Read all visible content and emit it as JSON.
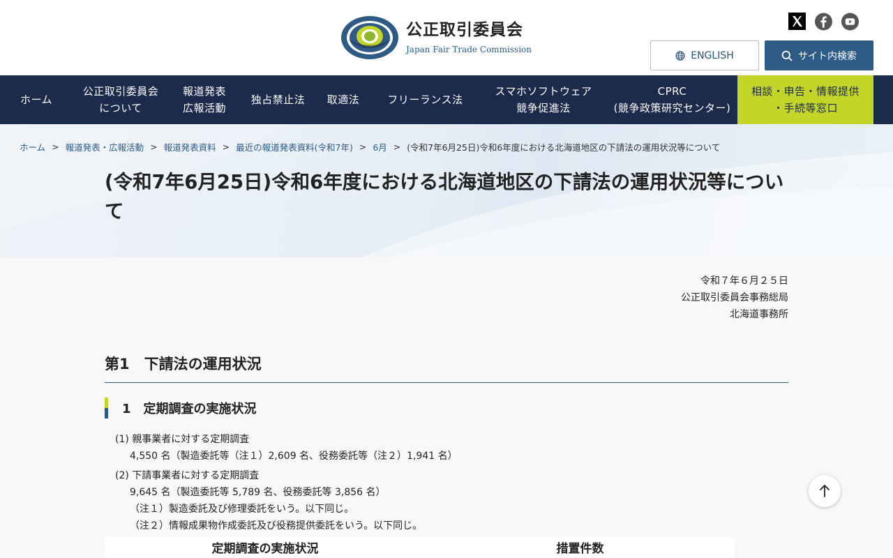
{
  "header": {
    "logo_jp": "公正取引委員会",
    "logo_en": "Japan Fair Trade Commission",
    "logo_seal_text": "JAPAN FAIR TRADE COMMISSION",
    "english_label": "ENGLISH",
    "search_label": "サイト内検索"
  },
  "social": [
    {
      "name": "x-icon"
    },
    {
      "name": "facebook-icon"
    },
    {
      "name": "youtube-icon"
    }
  ],
  "nav": {
    "items": [
      {
        "label": "ホーム"
      },
      {
        "label": "公正取引委員会\nについて"
      },
      {
        "label": "報道発表\n広報活動"
      },
      {
        "label": "独占禁止法"
      },
      {
        "label": "取適法"
      },
      {
        "label": "フリーランス法"
      },
      {
        "label": "スマホソフトウェア\n競争促進法"
      },
      {
        "label": "CPRC\n(競争政策研究センター)"
      },
      {
        "label": "相談・申告・情報提供\n・手続等窓口"
      }
    ]
  },
  "breadcrumb": {
    "items": [
      {
        "label": "ホーム"
      },
      {
        "label": "報道発表・広報活動"
      },
      {
        "label": "報道発表資料"
      },
      {
        "label": "最近の報道発表資料(令和7年)"
      },
      {
        "label": "6月"
      },
      {
        "label": "(令和7年6月25日)令和6年度における北海道地区の下請法の運用状況等について"
      }
    ],
    "separator": ">"
  },
  "page_title": "(令和7年6月25日)令和6年度における北海道地区の下請法の運用状況等について",
  "date_block": {
    "date": "令和７年６月２５日",
    "org": "公正取引委員会事務総局",
    "office": "北海道事務所"
  },
  "section": {
    "h2": "第1　下請法の運用状況",
    "h3": "1　定期調査の実施状況",
    "item1_title": "(1) 親事業者に対する定期調査",
    "item1_detail": "4,550 名（製造委託等（注１）2,609 名、役務委託等（注２）1,941 名）",
    "item2_title": "(2) 下請事業者に対する定期調査",
    "item2_detail": "9,645 名（製造委託等 5,789 名、役務委託等 3,856 名）",
    "note1": "（注１）製造委託及び修理委託をいう。以下同じ。",
    "note2": "（注２）情報成果物作成委託及び役務提供委託をいう。以下同じ。"
  },
  "table": {
    "headers": [
      "定期調査の実施状況",
      "措置件数"
    ]
  },
  "colors": {
    "navy": "#1c2a4b",
    "accent_blue": "#2e5b85",
    "lime": "#c4d52a"
  }
}
